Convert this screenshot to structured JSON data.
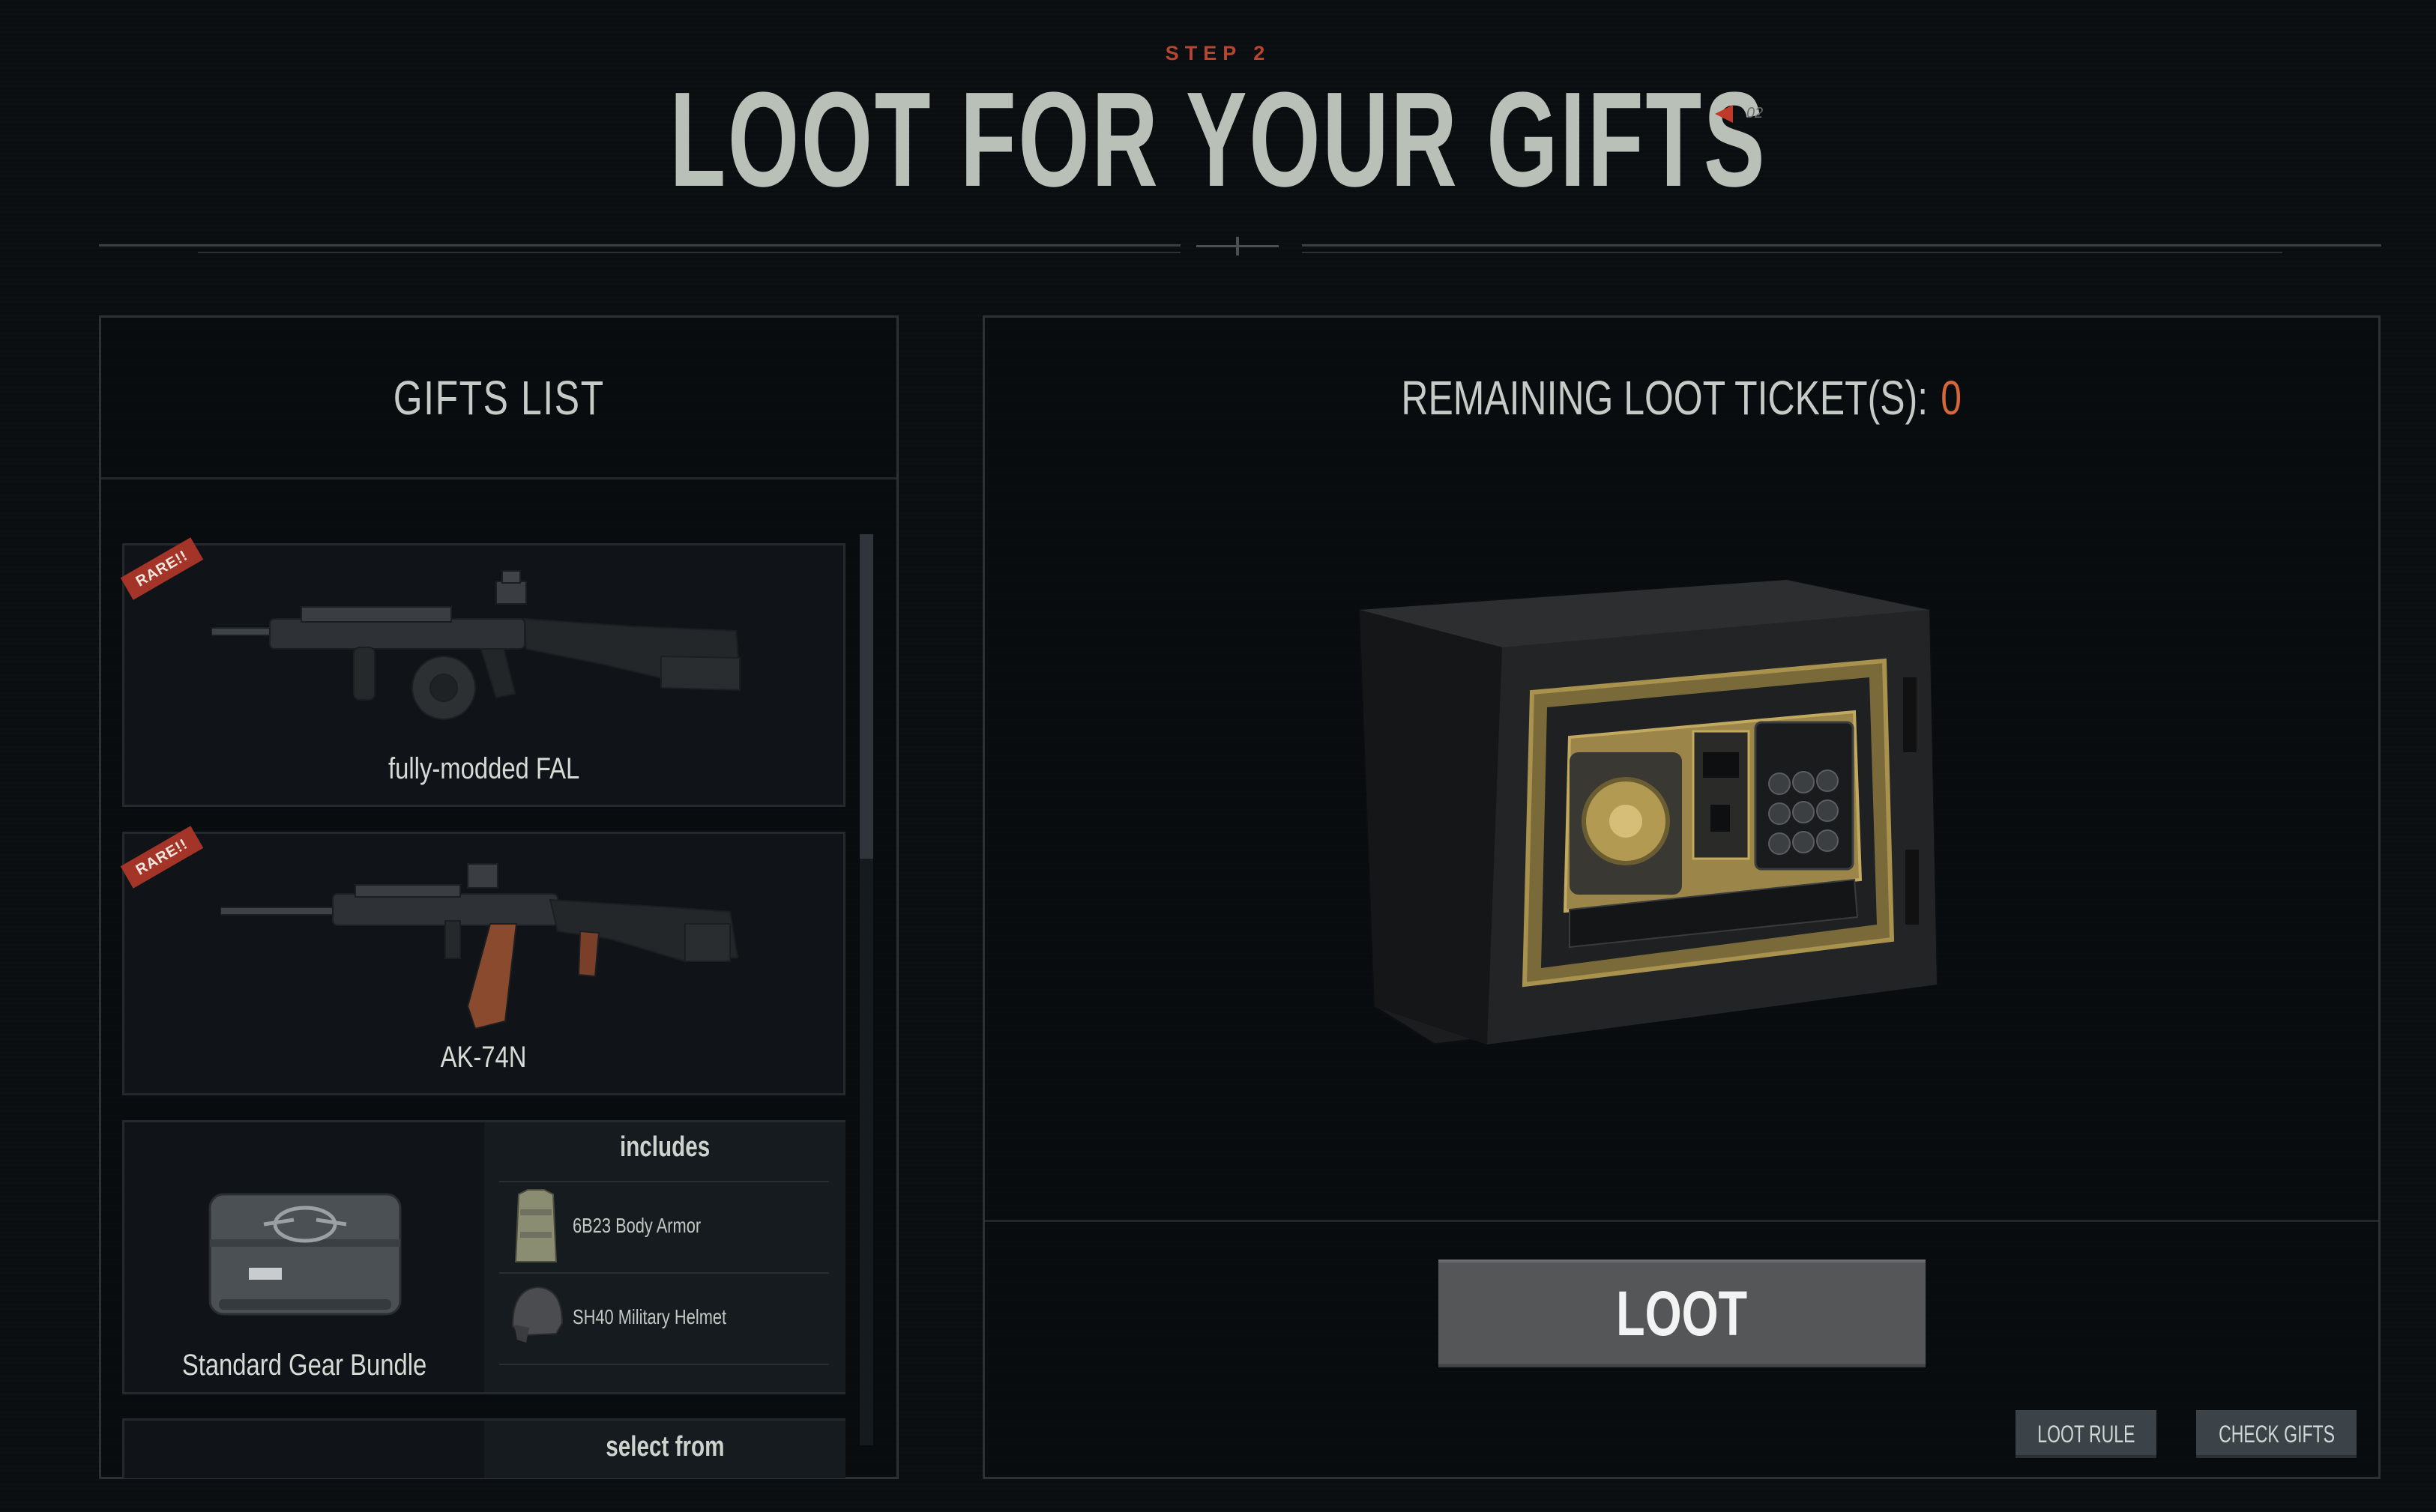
{
  "header": {
    "step_label": "STEP 2",
    "title": "LOOT FOR YOUR GIFTS",
    "marker_number": "02"
  },
  "gifts_panel": {
    "title": "GIFTS LIST",
    "items": [
      {
        "name": "fully-modded FAL",
        "badge": "RARE!!",
        "icon": "rifle-fal-icon"
      },
      {
        "name": "AK-74N",
        "badge": "RARE!!",
        "icon": "rifle-ak-icon"
      },
      {
        "name": "Standard Gear Bundle",
        "icon": "gear-case-icon",
        "includes_title": "includes",
        "includes": [
          {
            "label": "6B23 Body Armor",
            "icon": "body-armor-icon"
          },
          {
            "label": "SH40 Military Helmet",
            "icon": "helmet-icon"
          }
        ]
      },
      {
        "select_title": "select from"
      }
    ]
  },
  "loot_panel": {
    "ticket_label": "REMAINING LOOT TICKET(S):",
    "ticket_count": "0",
    "safe_icon": "safe-icon",
    "loot_button": "LOOT",
    "loot_rule_button": "LOOT RULE",
    "check_gifts_button": "CHECK GIFTS"
  },
  "colors": {
    "background": "#0b0e11",
    "accent_red": "#c0392b",
    "ticket_orange": "#d4683a",
    "title_grey": "#b9c0b8"
  }
}
